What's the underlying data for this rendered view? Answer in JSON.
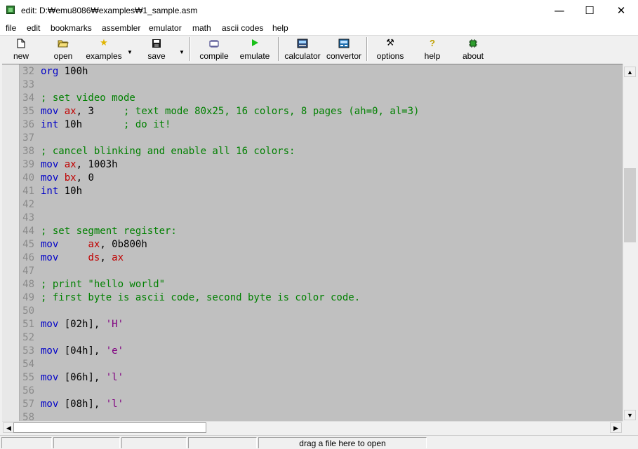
{
  "window": {
    "title": "edit: D:₩emu8086₩examples₩1_sample.asm",
    "minimize_glyph": "—",
    "maximize_glyph": "☐",
    "close_glyph": "✕"
  },
  "menu": [
    "file",
    "edit",
    "bookmarks",
    "assembler",
    "emulator",
    "math",
    "ascii codes",
    "help"
  ],
  "toolbar": {
    "new": "new",
    "open": "open",
    "examples": "examples",
    "save": "save",
    "compile": "compile",
    "emulate": "emulate",
    "calculator": "calculator",
    "convertor": "convertor",
    "options": "options",
    "help": "help",
    "about": "about",
    "dropdown_glyph": "▼",
    "icons": {
      "new": "new-document-icon",
      "open": "open-folder-icon",
      "examples": "star-icon",
      "save": "floppy-disk-icon",
      "compile": "compile-icon",
      "emulate": "play-icon",
      "calculator": "calculator-icon",
      "convertor": "convertor-icon",
      "options": "tools-icon",
      "help": "question-icon",
      "about": "chip-icon"
    }
  },
  "editor": {
    "lines": [
      {
        "n": "32",
        "code": [
          [
            "kw",
            "org"
          ],
          [
            "num",
            " 100h"
          ]
        ]
      },
      {
        "n": "33",
        "code": []
      },
      {
        "n": "34",
        "code": [
          [
            "cmt",
            "; set video mode"
          ]
        ]
      },
      {
        "n": "35",
        "code": [
          [
            "kw",
            "mov"
          ],
          [
            "num",
            " "
          ],
          [
            "reg",
            "ax"
          ],
          [
            "num",
            ", 3     "
          ],
          [
            "cmt",
            "; text mode 80x25, 16 colors, 8 pages (ah=0, al=3)"
          ]
        ]
      },
      {
        "n": "36",
        "code": [
          [
            "kw",
            "int"
          ],
          [
            "num",
            " 10h       "
          ],
          [
            "cmt",
            "; do it!"
          ]
        ]
      },
      {
        "n": "37",
        "code": []
      },
      {
        "n": "38",
        "code": [
          [
            "cmt",
            "; cancel blinking and enable all 16 colors:"
          ]
        ]
      },
      {
        "n": "39",
        "code": [
          [
            "kw",
            "mov"
          ],
          [
            "num",
            " "
          ],
          [
            "reg",
            "ax"
          ],
          [
            "num",
            ", 1003h"
          ]
        ]
      },
      {
        "n": "40",
        "code": [
          [
            "kw",
            "mov"
          ],
          [
            "num",
            " "
          ],
          [
            "reg",
            "bx"
          ],
          [
            "num",
            ", 0"
          ]
        ]
      },
      {
        "n": "41",
        "code": [
          [
            "kw",
            "int"
          ],
          [
            "num",
            " 10h"
          ]
        ]
      },
      {
        "n": "42",
        "code": []
      },
      {
        "n": "43",
        "code": []
      },
      {
        "n": "44",
        "code": [
          [
            "cmt",
            "; set segment register:"
          ]
        ]
      },
      {
        "n": "45",
        "code": [
          [
            "kw",
            "mov"
          ],
          [
            "num",
            "     "
          ],
          [
            "reg",
            "ax"
          ],
          [
            "num",
            ", 0b800h"
          ]
        ]
      },
      {
        "n": "46",
        "code": [
          [
            "kw",
            "mov"
          ],
          [
            "num",
            "     "
          ],
          [
            "reg",
            "ds"
          ],
          [
            "num",
            ", "
          ],
          [
            "reg",
            "ax"
          ]
        ]
      },
      {
        "n": "47",
        "code": []
      },
      {
        "n": "48",
        "code": [
          [
            "cmt",
            "; print \"hello world\""
          ]
        ]
      },
      {
        "n": "49",
        "code": [
          [
            "cmt",
            "; first byte is ascii code, second byte is color code."
          ]
        ]
      },
      {
        "n": "50",
        "code": []
      },
      {
        "n": "51",
        "code": [
          [
            "kw",
            "mov"
          ],
          [
            "num",
            " [02h], "
          ],
          [
            "str",
            "'H'"
          ]
        ]
      },
      {
        "n": "52",
        "code": []
      },
      {
        "n": "53",
        "code": [
          [
            "kw",
            "mov"
          ],
          [
            "num",
            " [04h], "
          ],
          [
            "str",
            "'e'"
          ]
        ]
      },
      {
        "n": "54",
        "code": []
      },
      {
        "n": "55",
        "code": [
          [
            "kw",
            "mov"
          ],
          [
            "num",
            " [06h], "
          ],
          [
            "str",
            "'l'"
          ]
        ]
      },
      {
        "n": "56",
        "code": []
      },
      {
        "n": "57",
        "code": [
          [
            "kw",
            "mov"
          ],
          [
            "num",
            " [08h], "
          ],
          [
            "str",
            "'l'"
          ]
        ]
      },
      {
        "n": "58",
        "code": []
      }
    ]
  },
  "scrollbars": {
    "up": "▲",
    "down": "▼",
    "left": "◀",
    "right": "▶"
  },
  "status": {
    "drag_hint": "drag a file here to open"
  }
}
